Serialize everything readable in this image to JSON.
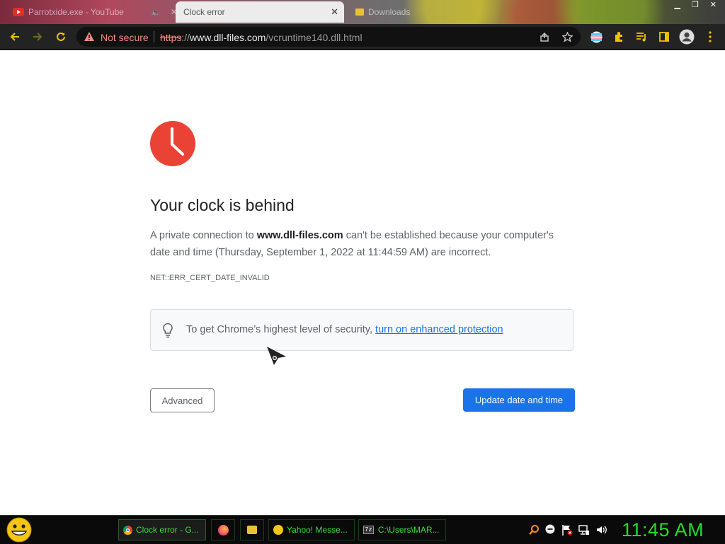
{
  "browser": {
    "tabs": [
      {
        "label": "Parrotxide.exe - YouTube",
        "state": "inactive"
      },
      {
        "label": "Clock error",
        "state": "active"
      },
      {
        "label": "Downloads",
        "state": "inactive"
      }
    ],
    "address": {
      "security_label": "Not secure",
      "scheme": "https",
      "separator": "://",
      "host": "www.dll-files.com",
      "path": "/vcruntime140.dll.html"
    }
  },
  "page": {
    "heading": "Your clock is behind",
    "para_prefix": "A private connection to ",
    "para_host": "www.dll-files.com",
    "para_suffix": " can't be established because your computer's date and time (Thursday, September 1, 2022 at 11:44:59 AM) are incorrect.",
    "error_code": "NET::ERR_CERT_DATE_INVALID",
    "tip_text": "To get Chrome’s highest level of security, ",
    "tip_link": "turn on enhanced protection",
    "advanced_button": "Advanced",
    "update_button": "Update date and time"
  },
  "taskbar": {
    "tasks": [
      {
        "label": "Clock error - G..."
      },
      {
        "label": "Yahoo! Messe..."
      },
      {
        "label": "C:\\Users\\MAR..."
      }
    ],
    "z7_label": "7z",
    "clock": "11:45 AM"
  },
  "colors": {
    "primary_button": "#1a73e8",
    "clock_icon": "#ea4335",
    "not_secure": "#f28b82",
    "taskbar_text": "#22dd22"
  }
}
